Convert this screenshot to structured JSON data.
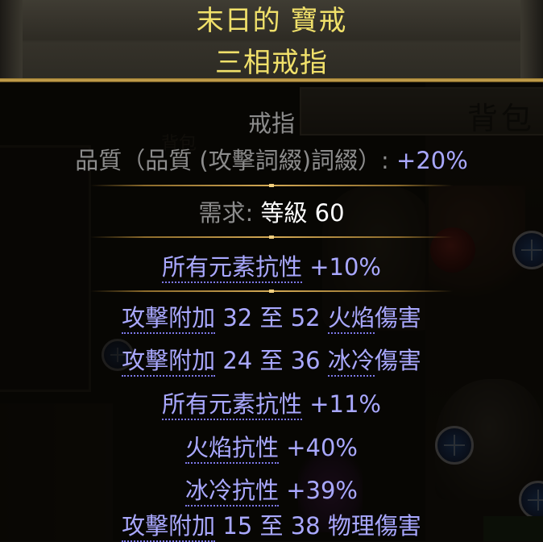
{
  "background": {
    "stash_label": "背包",
    "ghost_label": "背包"
  },
  "item": {
    "name": "末日的 寶戒",
    "base_type": "三相戒指",
    "item_class": "戒指",
    "quality_label": "品質（品質 (攻擊詞綴)詞綴）: ",
    "quality_value": "+20%",
    "requirement_label": "需求: ",
    "requirement_value": "等級 60",
    "implicit": [
      {
        "pre": "",
        "u": "所有元素抗性",
        "post": " +10%"
      }
    ],
    "explicit": [
      {
        "pre": "",
        "u": "攻擊附加",
        "mid": " 32 至 52 ",
        "u2": "火焰",
        "post": "傷害"
      },
      {
        "pre": "",
        "u": "攻擊附加",
        "mid": " 24 至 36 ",
        "u2": "冰冷",
        "post": "傷害"
      },
      {
        "pre": "",
        "u": "所有元素抗性",
        "mid": " +11%",
        "u2": "",
        "post": ""
      },
      {
        "pre": "",
        "u": "火焰抗性",
        "mid": " +40%",
        "u2": "",
        "post": ""
      },
      {
        "pre": "",
        "u": "冰冷抗性",
        "mid": " +39%",
        "u2": "",
        "post": ""
      },
      {
        "pre": "",
        "u": "攻擊附加",
        "mid": " 15 至 38 ",
        "u2": "",
        "post": "物理傷害"
      }
    ]
  },
  "colors": {
    "item_name": "#f0e06a",
    "magic_mod": "#a9a8ff",
    "separator": "#d2a854"
  }
}
